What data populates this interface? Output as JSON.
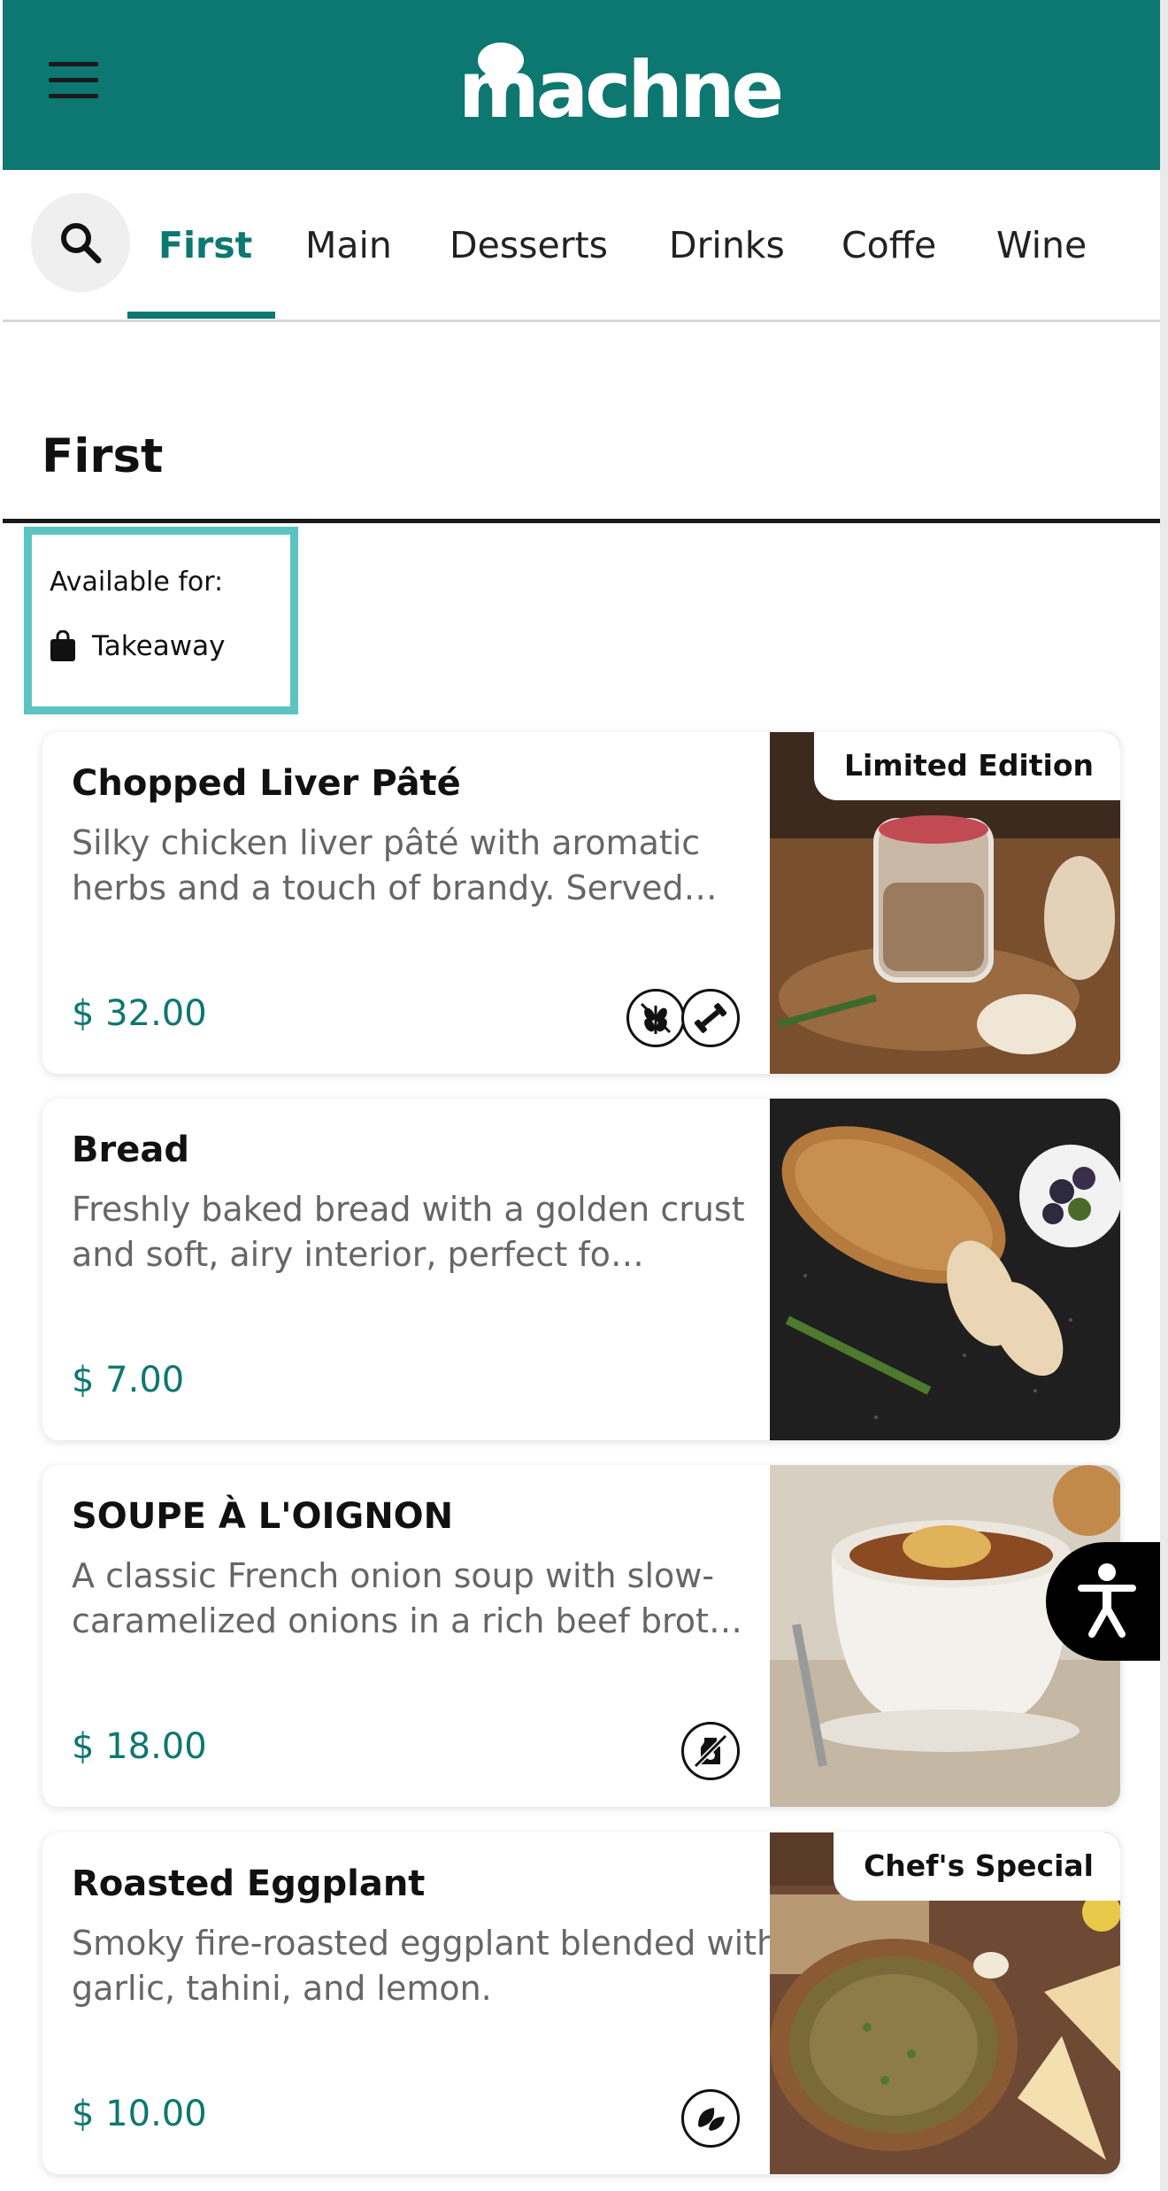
{
  "header": {
    "logo_text": "machne",
    "menu_icon": "hamburger-icon",
    "brand_color": "#0d7771"
  },
  "tabs": [
    {
      "label": "First",
      "active": true
    },
    {
      "label": "Main",
      "active": false
    },
    {
      "label": "Desserts",
      "active": false
    },
    {
      "label": "Drinks",
      "active": false
    },
    {
      "label": "Coffe",
      "active": false
    },
    {
      "label": "Wine",
      "active": false
    }
  ],
  "search": {
    "icon": "search-icon"
  },
  "section": {
    "title": "First",
    "available_label": "Available for:",
    "available_option": "Takeaway",
    "highlight_color": "#5cc3c3"
  },
  "items": [
    {
      "name": "Chopped Liver Pâté",
      "description": "Silky chicken liver pâté with aromatic herbs and a touch of brandy. Served…",
      "price": "$ 32.00",
      "badge": "Limited Edition",
      "diet_icons": [
        "no-grain-icon",
        "protein-icon"
      ]
    },
    {
      "name": "Bread",
      "description": "Freshly baked bread with a golden crust and soft, airy interior, perfect fo…",
      "price": "$ 7.00",
      "badge": "",
      "diet_icons": []
    },
    {
      "name": "SOUPE À L'OIGNON",
      "description": "A classic French onion soup with slow-caramelized onions in a rich beef brot…",
      "price": "$ 18.00",
      "badge": "",
      "diet_icons": [
        "no-dairy-icon"
      ]
    },
    {
      "name": "Roasted Eggplant",
      "description": "Smoky fire-roasted eggplant blended with garlic, tahini, and lemon.",
      "price": "$ 10.00",
      "badge": "Chef's Special",
      "diet_icons": [
        "vegan-leaf-icon"
      ]
    }
  ],
  "accessibility": {
    "icon": "accessibility-icon"
  }
}
